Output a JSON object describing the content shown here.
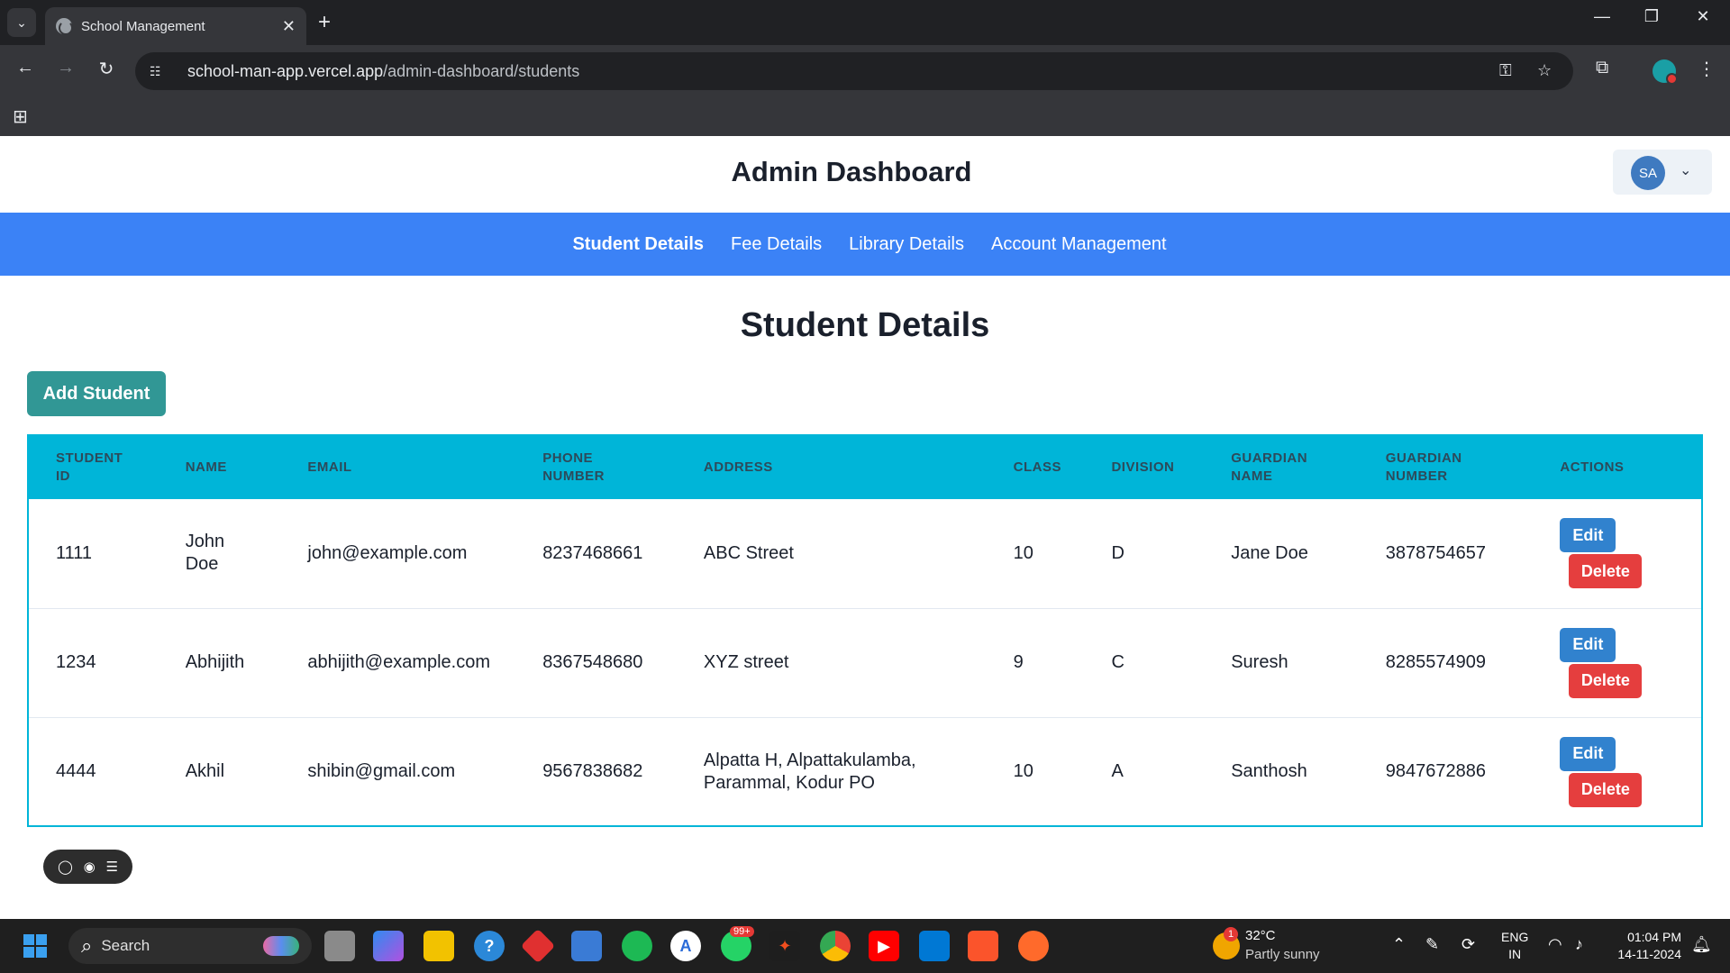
{
  "browser": {
    "tab_title": "School Management",
    "tab_close": "✕",
    "new_tab": "+",
    "url_host": "school-man-app.vercel.app",
    "url_path": "/admin-dashboard/students",
    "window_controls": [
      "—",
      "❐",
      "✕"
    ]
  },
  "header": {
    "title": "Admin Dashboard",
    "user_initials": "SA"
  },
  "nav": {
    "items": [
      "Student Details",
      "Fee Details",
      "Library Details",
      "Account Management"
    ],
    "active": "Student Details"
  },
  "page": {
    "title": "Student Details",
    "add_button": "Add Student"
  },
  "table": {
    "headers": [
      [
        "STUDENT",
        "ID"
      ],
      [
        "NAME"
      ],
      [
        "EMAIL"
      ],
      [
        "PHONE",
        "NUMBER"
      ],
      [
        "ADDRESS"
      ],
      [
        "CLASS"
      ],
      [
        "DIVISION"
      ],
      [
        "GUARDIAN",
        "NAME"
      ],
      [
        "GUARDIAN",
        "NUMBER"
      ],
      [
        "ACTIONS"
      ]
    ],
    "rows": [
      {
        "id": "1111",
        "name": [
          "John",
          "Doe"
        ],
        "email": "john@example.com",
        "phone": "8237468661",
        "address": [
          "ABC Street"
        ],
        "class": "10",
        "division": "D",
        "guardian_name": "Jane Doe",
        "guardian_number": "3878754657"
      },
      {
        "id": "1234",
        "name": [
          "Abhijith"
        ],
        "email": "abhijith@example.com",
        "phone": "8367548680",
        "address": [
          "XYZ street"
        ],
        "class": "9",
        "division": "C",
        "guardian_name": "Suresh",
        "guardian_number": "8285574909"
      },
      {
        "id": "4444",
        "name": [
          "Akhil"
        ],
        "email": "shibin@gmail.com",
        "phone": "9567838682",
        "address": [
          "Alpatta H, Alpattakulamba,",
          "Parammal, Kodur PO"
        ],
        "class": "10",
        "division": "A",
        "guardian_name": "Santhosh",
        "guardian_number": "9847672886"
      }
    ],
    "edit_label": "Edit",
    "delete_label": "Delete"
  },
  "taskbar": {
    "search_label": "Search",
    "whatsapp_badge": "99+",
    "weather_badge": "1",
    "weather_temp": "32°C",
    "weather_desc": "Partly sunny",
    "lang_top": "ENG",
    "lang_bottom": "IN",
    "time": "01:04 PM",
    "date": "14-11-2024"
  }
}
